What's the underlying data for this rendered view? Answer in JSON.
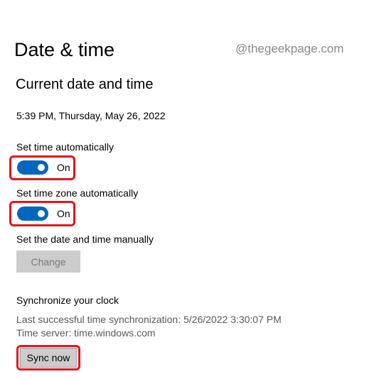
{
  "page": {
    "title": "Date & time",
    "watermark": "@thegeekpage.com"
  },
  "current": {
    "section_title": "Current date and time",
    "datetime": "5:39 PM, Thursday, May 26, 2022"
  },
  "set_time_auto": {
    "label": "Set time automatically",
    "state": "On",
    "enabled": true
  },
  "set_timezone_auto": {
    "label": "Set time zone automatically",
    "state": "On",
    "enabled": true
  },
  "manual": {
    "label": "Set the date and time manually",
    "button_label": "Change"
  },
  "sync": {
    "section_label": "Synchronize your clock",
    "last_sync": "Last successful time synchronization: 5/26/2022 3:30:07 PM",
    "time_server": "Time server: time.windows.com",
    "button_label": "Sync now"
  },
  "colors": {
    "accent": "#0067c0",
    "highlight": "#e8131a"
  }
}
